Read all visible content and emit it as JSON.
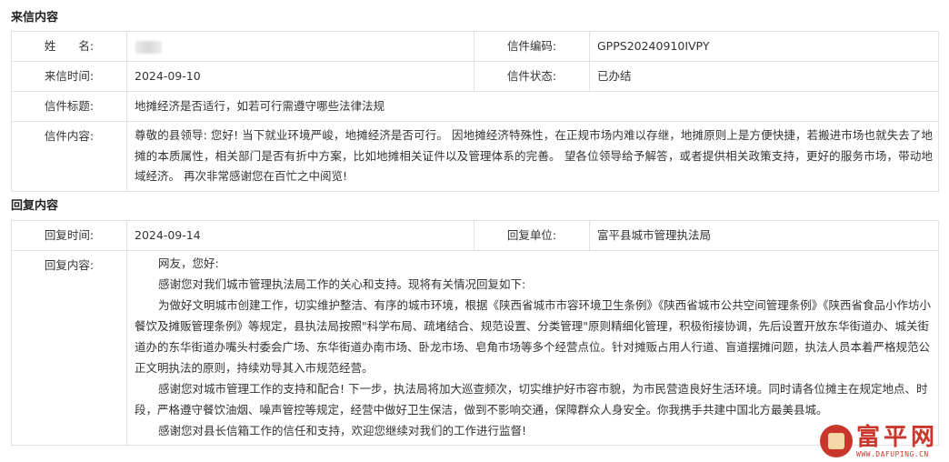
{
  "letter": {
    "section_title": "来信内容",
    "name_label": "姓　　名:",
    "code_label": "信件编码:",
    "code_value": "GPPS20240910IVPY",
    "time_label": "来信时间:",
    "time_value": "2024-09-10",
    "status_label": "信件状态:",
    "status_value": "已办结",
    "subject_label": "信件标题:",
    "subject_value": "地摊经济是否适行，如若可行需遵守哪些法律法规",
    "content_label": "信件内容:",
    "content_value": "尊敬的县领导: 您好! 当下就业环境严峻，地摊经济是否可行。 因地摊经济特殊性，在正规市场内难以存继，地摊原则上是方便快捷，若搬进市场也就失去了地摊的本质属性，相关部门是否有折中方案，比如地摊相关证件以及管理体系的完善。 望各位领导给予解答，或者提供相关政策支持，更好的服务市场，带动地域经济。 再次非常感谢您在百忙之中阅览!"
  },
  "reply": {
    "section_title": "回复内容",
    "time_label": "回复时间:",
    "time_value": "2024-09-14",
    "unit_label": "回复单位:",
    "unit_value": "富平县城市管理执法局",
    "content_label": "回复内容:",
    "paragraphs": [
      "网友，您好:",
      "感谢您对我们城市管理执法局工作的关心和支持。现将有关情况回复如下:",
      "为做好文明城市创建工作，切实维护整洁、有序的城市环境，根据《陕西省城市市容环境卫生条例》《陕西省城市公共空间管理条例》《陕西省食品小作坊小餐饮及摊贩管理条例》等规定，县执法局按照\"科学布局、疏堵结合、规范设置、分类管理\"原则精细化管理，积极衔接协调，先后设置开放东华街道办、城关街道办的东华街道办嘴头村委会广场、东华街道办南市场、卧龙市场、皂角市场等多个经营点位。针对摊贩占用人行道、盲道摆摊问题，执法人员本着严格规范公正文明执法的原则，持续劝导其入市规范经营。",
      "感谢您对城市管理工作的支持和配合! 下一步，执法局将加大巡查频次，切实维护好市容市貌，为市民营造良好生活环境。同时请各位摊主在规定地点、时段，严格遵守餐饮油烟、噪声管控等规定，经营中做好卫生保洁，做到不影响交通，保障群众人身安全。你我携手共建中国北方最美县城。",
      "感谢您对县长信箱工作的信任和支持，欢迎您继续对我们的工作进行监督!"
    ]
  },
  "watermark": {
    "cn": "富平网",
    "en": "WWW.DAFUPING.CN"
  }
}
